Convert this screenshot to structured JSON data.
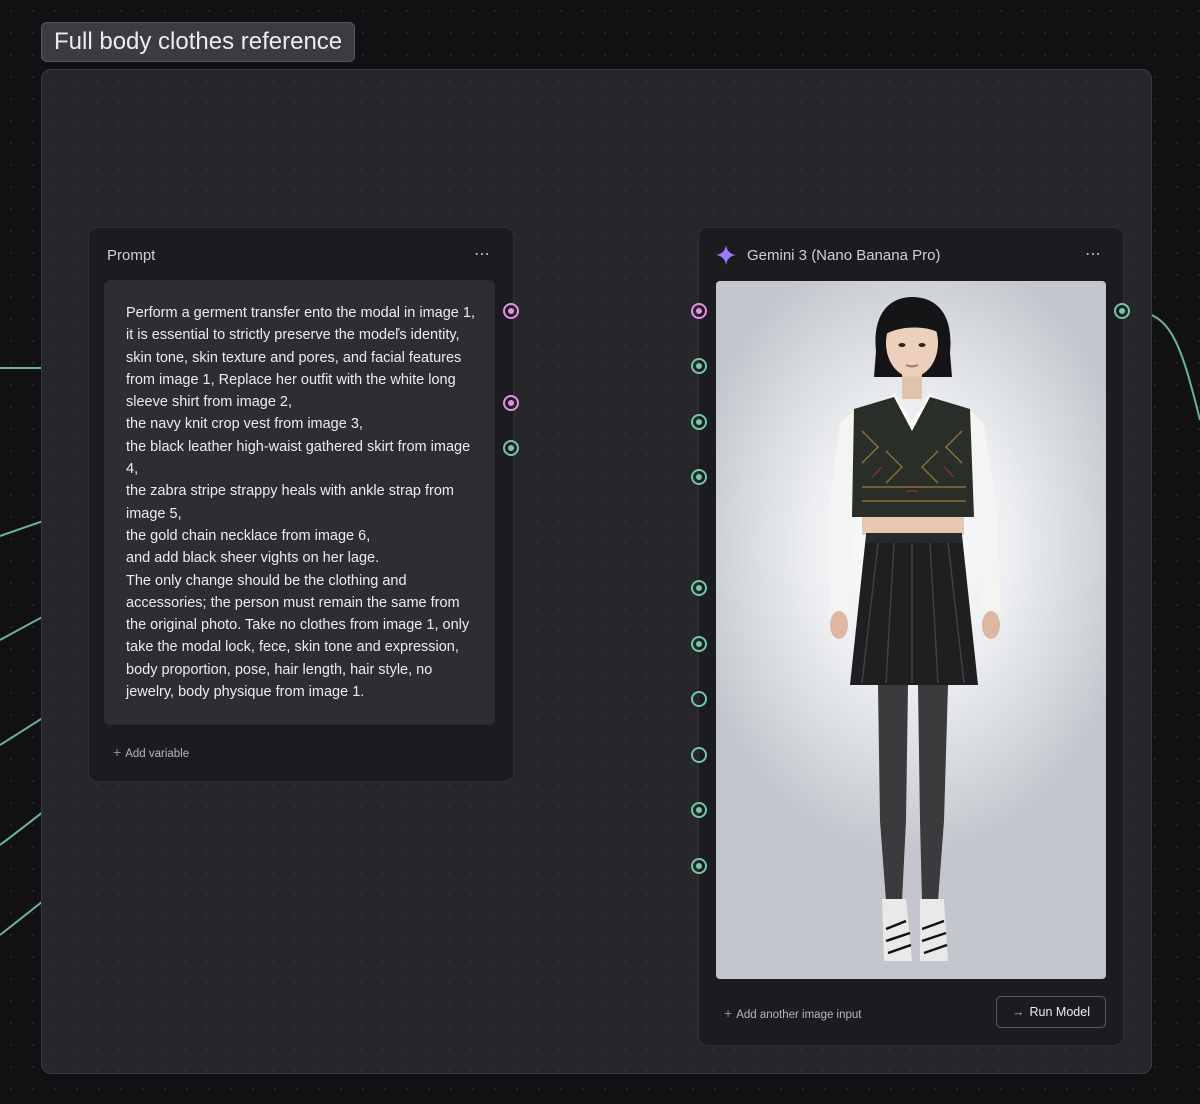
{
  "group": {
    "label": "Full body clothes reference"
  },
  "prompt_node": {
    "title": "Prompt",
    "menu_icon": "more-horizontal-icon",
    "text": "Perform a germent transfer ento the modal in image 1, it is essential to strictly preserve the modeľs identity, skin tone, skin texture and pores, and facial features from image 1, Replace her outfit with the white long sleeve shirt from image 2,\nthe navy knit crop vest from image 3,\nthe black leather high-waist gathered skirt from image 4,\nthe zabra stripe strappy heals with ankle strap from image 5,\nthe gold chain necklace from image 6,\nand add black sheer vights on her lage.\nThe only change should be the clothing and accessories; the person must remain the same from the original photo. Take no clothes from image 1, only take the modal lock, fece, skin tone and expression, body proportion, pose, hair length, hair style, no jewelry, body physique from image 1.",
    "add_variable_label": "Add variable"
  },
  "model_node": {
    "title": "Gemini 3 (Nano Banana Pro)",
    "icon": "gemini-sparkle-icon",
    "menu_icon": "more-horizontal-icon",
    "output_image": "generated-full-body-model-image",
    "add_image_label": "Add another image input",
    "run_label": "Run Model",
    "run_icon": "arrow-right-icon"
  },
  "colors": {
    "canvas_background": "#111114",
    "group_background": "#26262b",
    "node_background": "#1c1c20",
    "text_wire": "#e98ee8",
    "image_wire": "#6fc9a4"
  }
}
